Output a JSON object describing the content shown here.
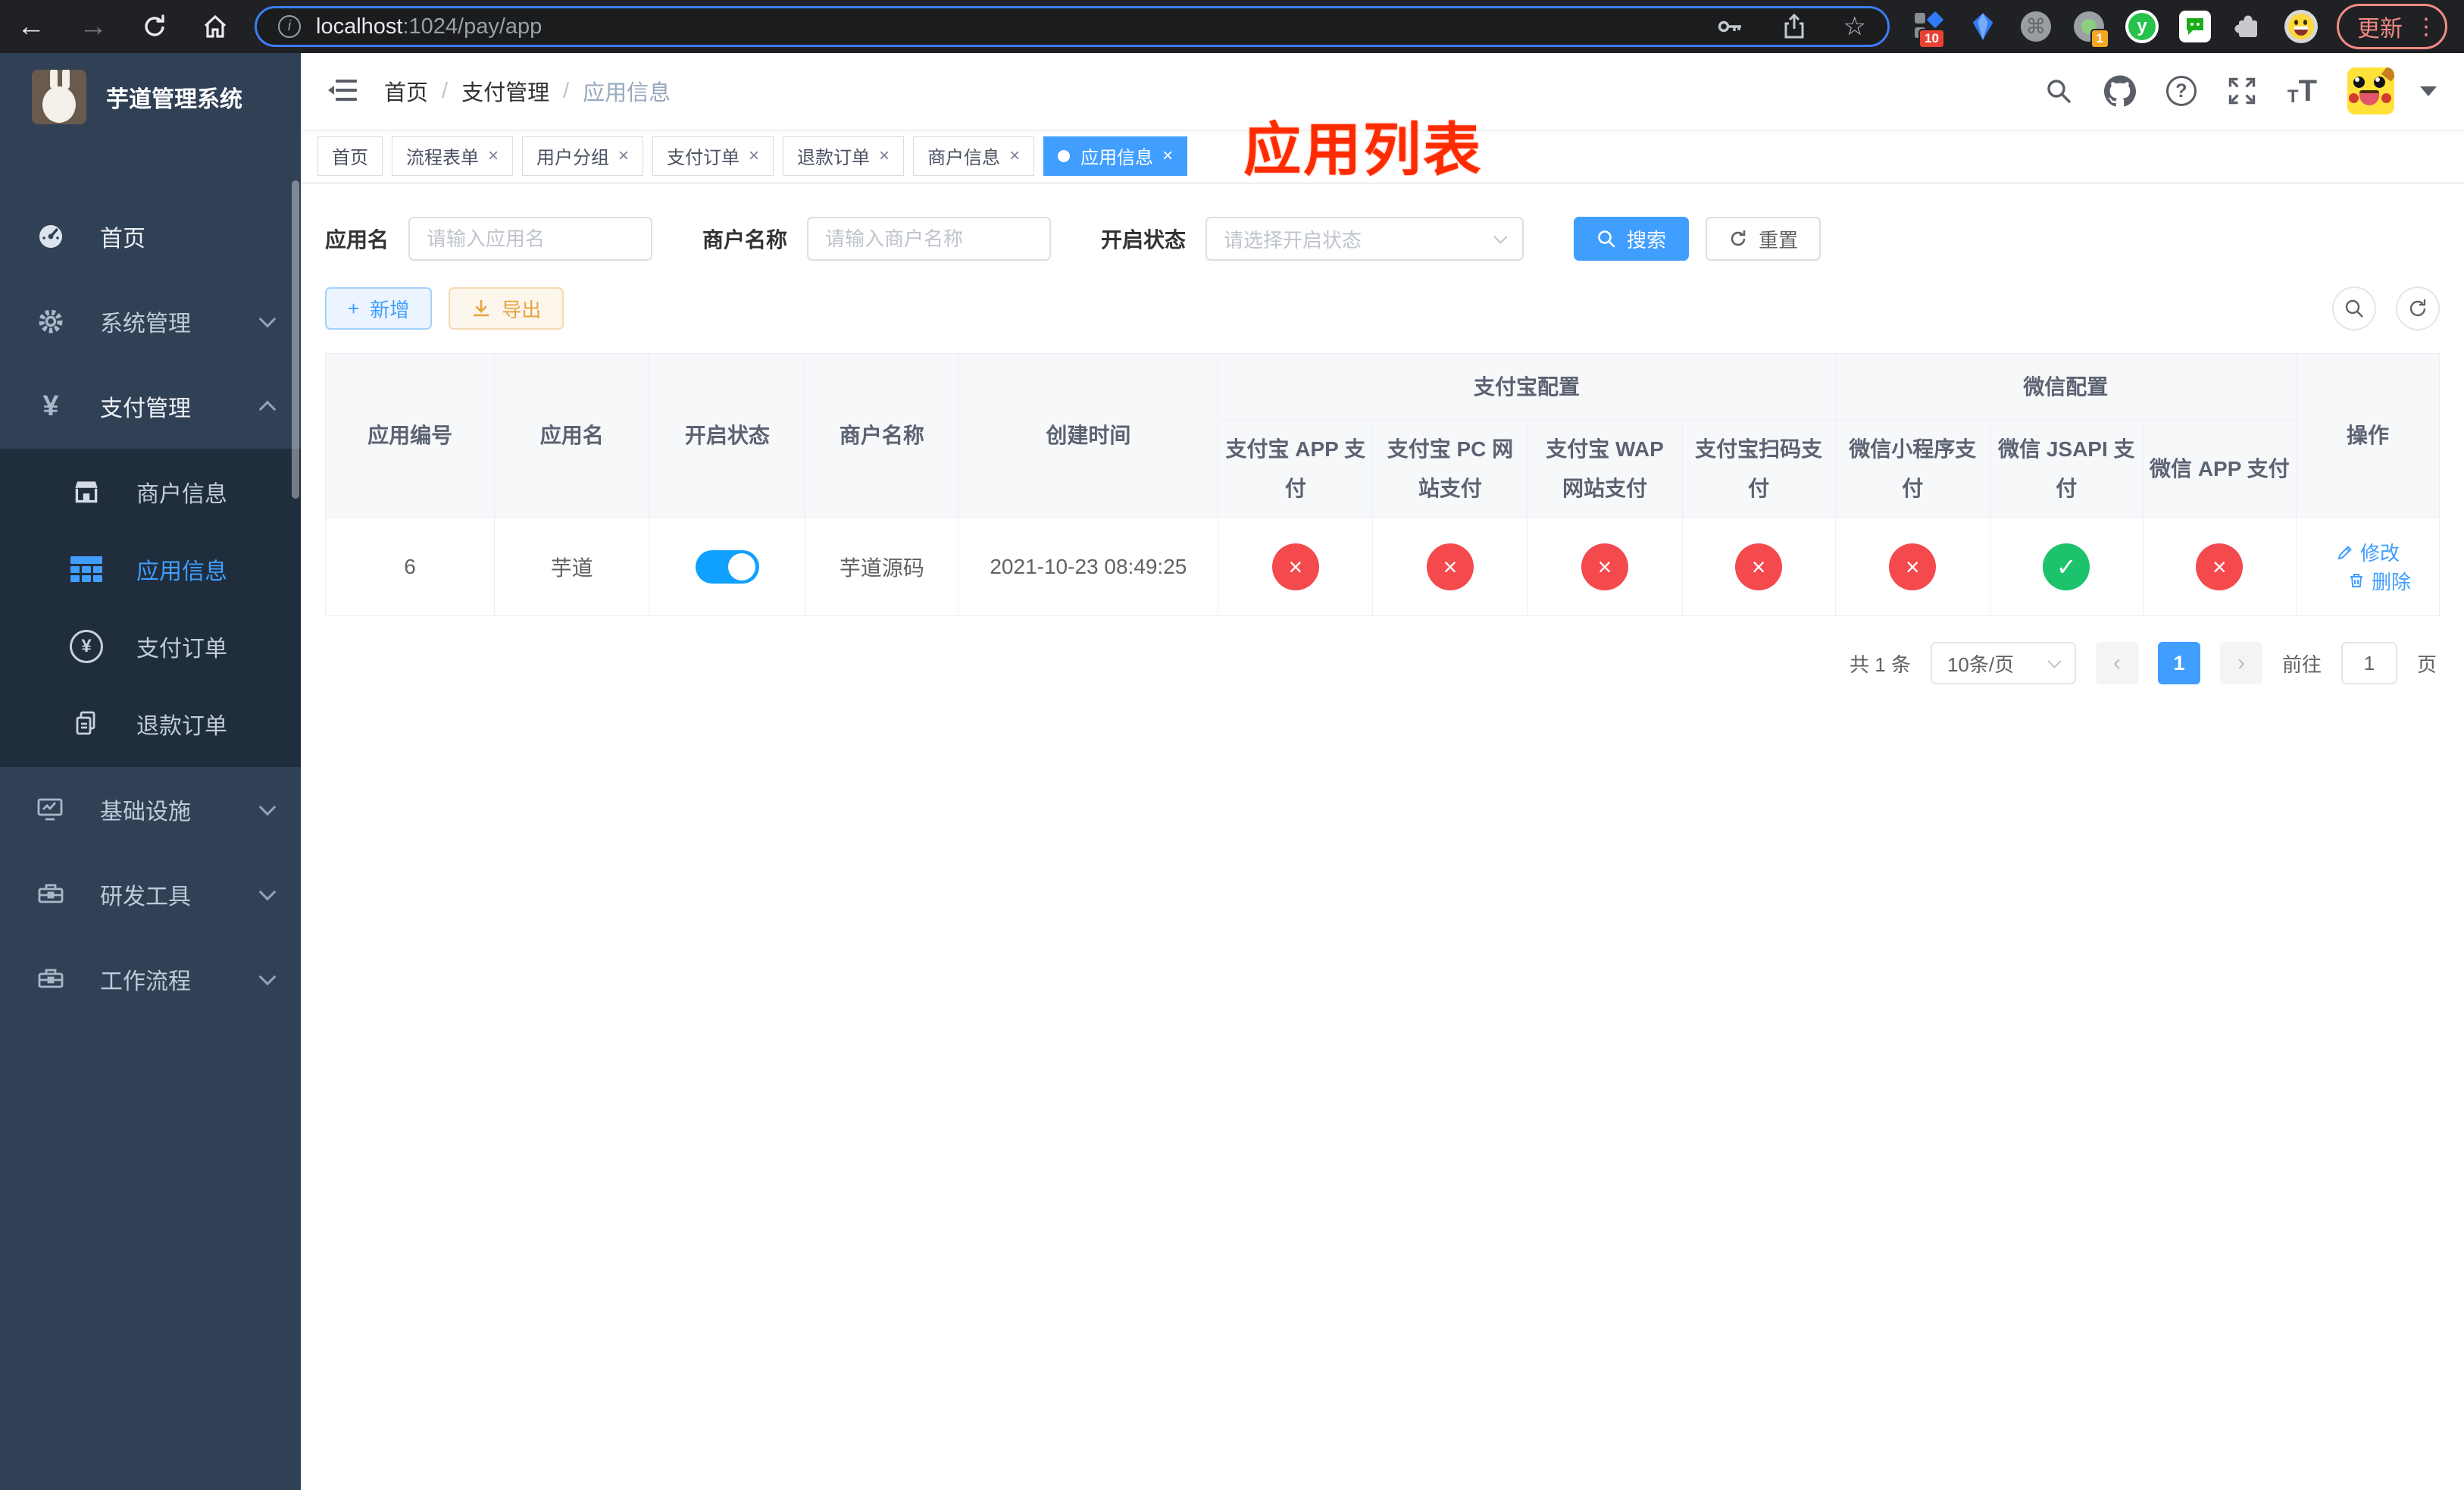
{
  "browser": {
    "url": {
      "host": "localhost",
      "path": ":1024/pay/app"
    },
    "update_button": "更新",
    "extension_badges": {
      "composite": "10",
      "profile": "1"
    },
    "y_extension_letter": "y"
  },
  "icons": {
    "back": "←",
    "forward": "→",
    "info": "i",
    "star": "☆",
    "command": "⌘",
    "close": "×",
    "check": "✓",
    "cross": "×",
    "kebab": "⋮",
    "question": "?",
    "prev": "‹",
    "next": "›",
    "plus": "+",
    "yen": "¥",
    "font_small": "T",
    "font_big": "T"
  },
  "annotation": {
    "text": "应用列表"
  },
  "sidebar": {
    "app_title": "芋道管理系统",
    "items": [
      {
        "label": "首页"
      },
      {
        "label": "系统管理"
      },
      {
        "label": "支付管理"
      },
      {
        "label": "基础设施"
      },
      {
        "label": "研发工具"
      },
      {
        "label": "工作流程"
      }
    ],
    "submenu": [
      {
        "label": "商户信息"
      },
      {
        "label": "应用信息"
      },
      {
        "label": "支付订单"
      },
      {
        "label": "退款订单"
      }
    ]
  },
  "navbar": {
    "breadcrumb": [
      "首页",
      "支付管理",
      "应用信息"
    ],
    "separator": "/"
  },
  "tabs": [
    {
      "label": "首页"
    },
    {
      "label": "流程表单"
    },
    {
      "label": "用户分组"
    },
    {
      "label": "支付订单"
    },
    {
      "label": "退款订单"
    },
    {
      "label": "商户信息"
    },
    {
      "label": "应用信息"
    }
  ],
  "search_form": {
    "app_name": {
      "label": "应用名",
      "placeholder": "请输入应用名",
      "value": ""
    },
    "merchant_name": {
      "label": "商户名称",
      "placeholder": "请输入商户名称",
      "value": ""
    },
    "status": {
      "label": "开启状态",
      "placeholder": "请选择开启状态",
      "value": ""
    },
    "search_button": "搜索",
    "reset_button": "重置"
  },
  "toolbar": {
    "add_button": "新增",
    "export_button": "导出"
  },
  "table": {
    "col_app_id": "应用编号",
    "col_app_name": "应用名",
    "col_status": "开启状态",
    "col_merchant": "商户名称",
    "col_created": "创建时间",
    "group_alipay": "支付宝配置",
    "group_wechat": "微信配置",
    "col_alipay_app": "支付宝 APP 支付",
    "col_alipay_pc": "支付宝 PC 网站支付",
    "col_alipay_wap": "支付宝 WAP 网站支付",
    "col_alipay_qr": "支付宝扫码支付",
    "col_wx_mini": "微信小程序支付",
    "col_wx_jsapi": "微信 JSAPI 支付",
    "col_wx_app": "微信 APP 支付",
    "col_actions": "操作",
    "row": {
      "id": "6",
      "app_name": "芋道",
      "enabled": true,
      "merchant": "芋道源码",
      "created_at": "2021-10-23 08:49:25",
      "pay_channels": {
        "alipay_app": false,
        "alipay_pc": false,
        "alipay_wap": false,
        "alipay_qr": false,
        "wx_mini": false,
        "wx_jsapi": true,
        "wx_app": false
      },
      "edit_label": "修改",
      "delete_label": "删除"
    }
  },
  "pagination": {
    "total_text": "共 1 条",
    "page_size": "10条/页",
    "current_page": "1",
    "goto_label": "前往",
    "goto_value": "1",
    "page_unit": "页"
  },
  "colors": {
    "accent": "#409eff",
    "success": "#1dc26d",
    "danger": "#f4494d",
    "warning": "#e6a23c",
    "sidebar": "#304156",
    "submenu": "#1f2d3d",
    "annotation": "#ff2b00"
  }
}
